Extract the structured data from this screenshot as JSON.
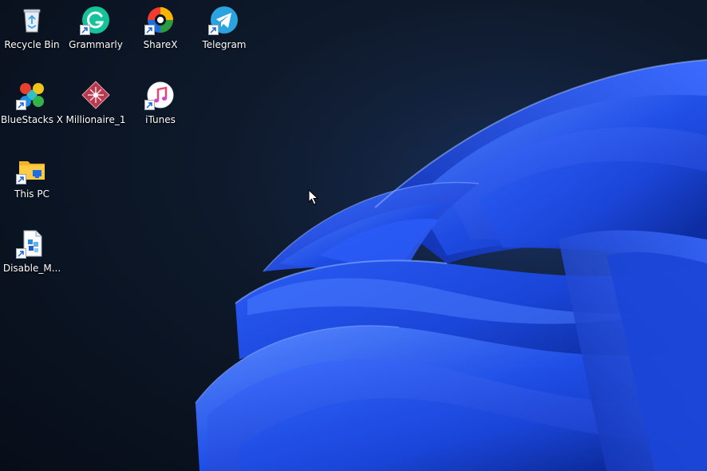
{
  "desktop": {
    "icons": [
      {
        "label": "Recycle Bin",
        "icon": "recycle-bin-icon",
        "shortcut": false
      },
      {
        "label": "Grammarly",
        "icon": "grammarly-icon",
        "shortcut": true
      },
      {
        "label": "ShareX",
        "icon": "sharex-icon",
        "shortcut": true
      },
      {
        "label": "Telegram",
        "icon": "telegram-icon",
        "shortcut": true
      },
      {
        "label": "BlueStacks X",
        "icon": "bluestacks-icon",
        "shortcut": true
      },
      {
        "label": "Millionaire_1",
        "icon": "millionaire-icon",
        "shortcut": false
      },
      {
        "label": "iTunes",
        "icon": "itunes-icon",
        "shortcut": true
      },
      {
        "label": "This PC",
        "icon": "this-pc-folder-icon",
        "shortcut": true
      },
      {
        "label": "Disable_M...",
        "icon": "script-file-icon",
        "shortcut": true
      }
    ]
  },
  "colors": {
    "background": "#0b1322",
    "bloom_blue": "#1f4fe0",
    "bloom_light": "#4c7dff",
    "label_text": "#ffffff"
  }
}
